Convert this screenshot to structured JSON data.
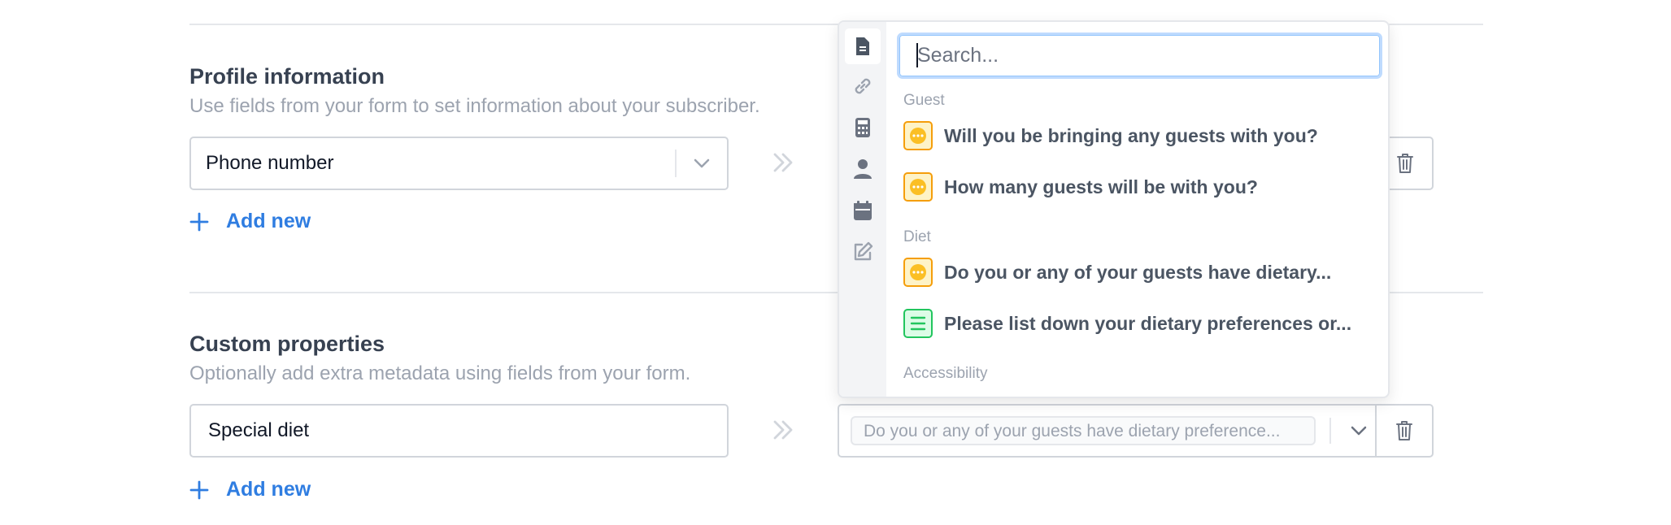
{
  "profile": {
    "title": "Profile information",
    "description": "Use fields from your form to set information about your subscriber.",
    "field_value": "Phone number",
    "add_new": "Add new"
  },
  "custom": {
    "title": "Custom properties",
    "description": "Optionally add extra metadata using fields from your form.",
    "field_value": "Special diet",
    "add_new": "Add new",
    "mapped_value": "Do you or any of your guests have dietary preference..."
  },
  "dropdown": {
    "search_placeholder": "Search...",
    "rail_icons": [
      "document-icon",
      "link-icon",
      "calculator-icon",
      "person-icon",
      "calendar-icon",
      "edit-icon"
    ],
    "groups": [
      {
        "label": "Guest",
        "options": [
          {
            "label": "Will you be bringing any guests with you?",
            "type": "choice"
          },
          {
            "label": "How many guests will be with you?",
            "type": "choice"
          }
        ]
      },
      {
        "label": "Diet",
        "options": [
          {
            "label": "Do you or any of your guests have dietary...",
            "type": "choice"
          },
          {
            "label": "Please list down your dietary preferences or...",
            "type": "long-text"
          }
        ]
      },
      {
        "label": "Accessibility",
        "options": []
      }
    ]
  },
  "colors": {
    "accent": "#2f7de1",
    "choice_badge": "#f59e0b",
    "text_badge": "#22c55e"
  }
}
